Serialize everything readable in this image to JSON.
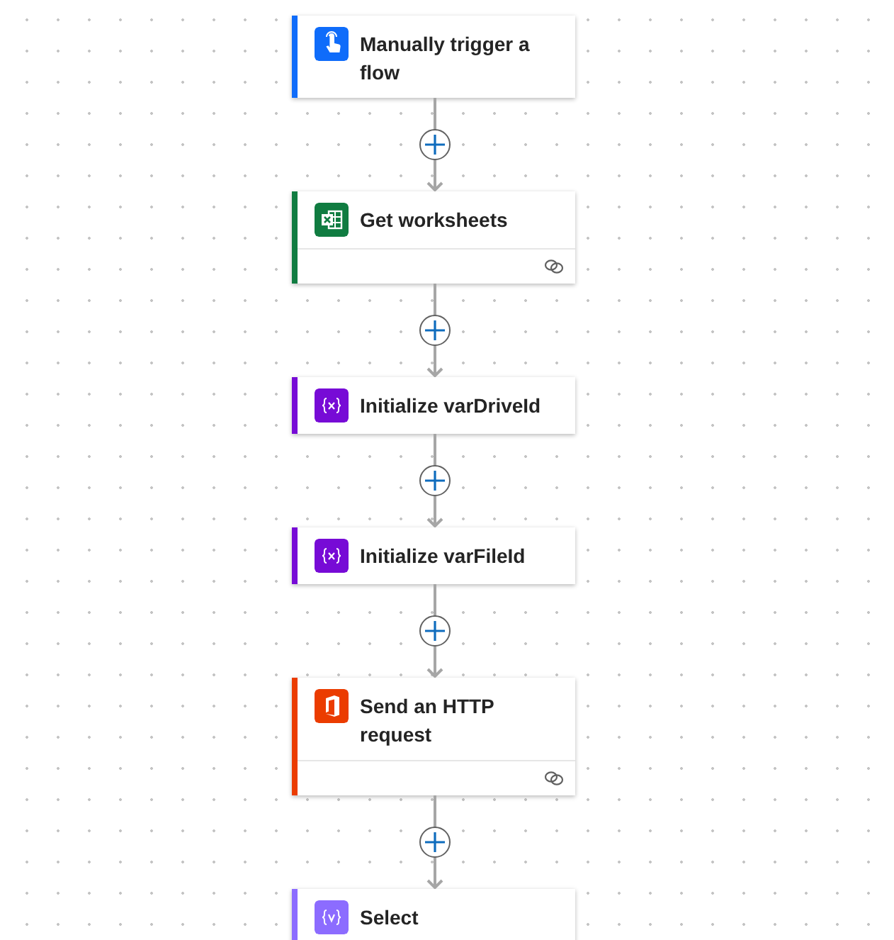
{
  "steps": [
    {
      "title": "Manually trigger a flow",
      "kind": "trigger",
      "color": "#0f6cfa",
      "connection": false
    },
    {
      "title": "Get worksheets",
      "kind": "excel",
      "color": "#107c41",
      "connection": true
    },
    {
      "title": "Initialize varDriveId",
      "kind": "variable",
      "color": "#770bd6",
      "connection": false
    },
    {
      "title": "Initialize varFileId",
      "kind": "variable",
      "color": "#770bd6",
      "connection": false
    },
    {
      "title": "Send an HTTP request",
      "kind": "office",
      "color": "#eb3c00",
      "connection": true
    },
    {
      "title": "Select",
      "kind": "select",
      "color": "#8c6cff",
      "connection": false
    }
  ]
}
